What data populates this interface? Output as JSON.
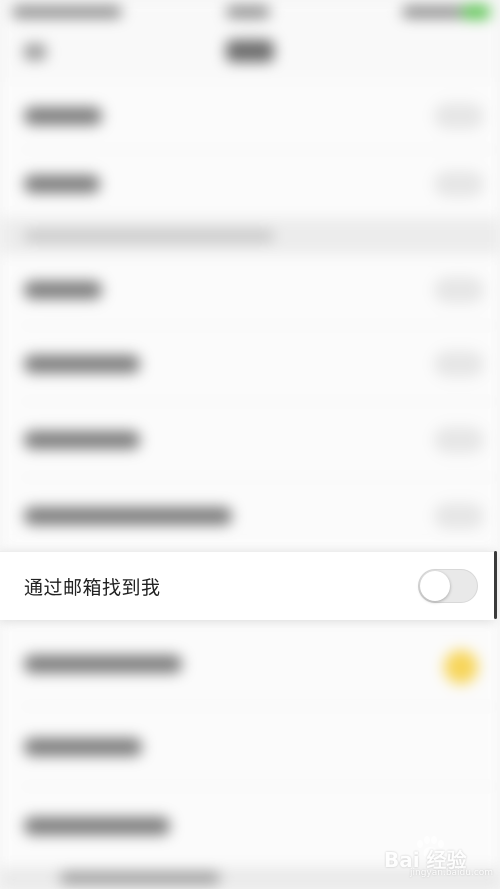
{
  "focused_setting": {
    "label": "通过邮箱找到我",
    "toggle_on": false
  },
  "colors": {
    "toggle_off_track": "#e9e9e9",
    "knob": "#ffffff",
    "background": "#f5f5f5",
    "accent_star": "#f7d55a"
  },
  "watermark": {
    "brand": "Bai 经验",
    "domain": "jingyan.baidu.com"
  }
}
